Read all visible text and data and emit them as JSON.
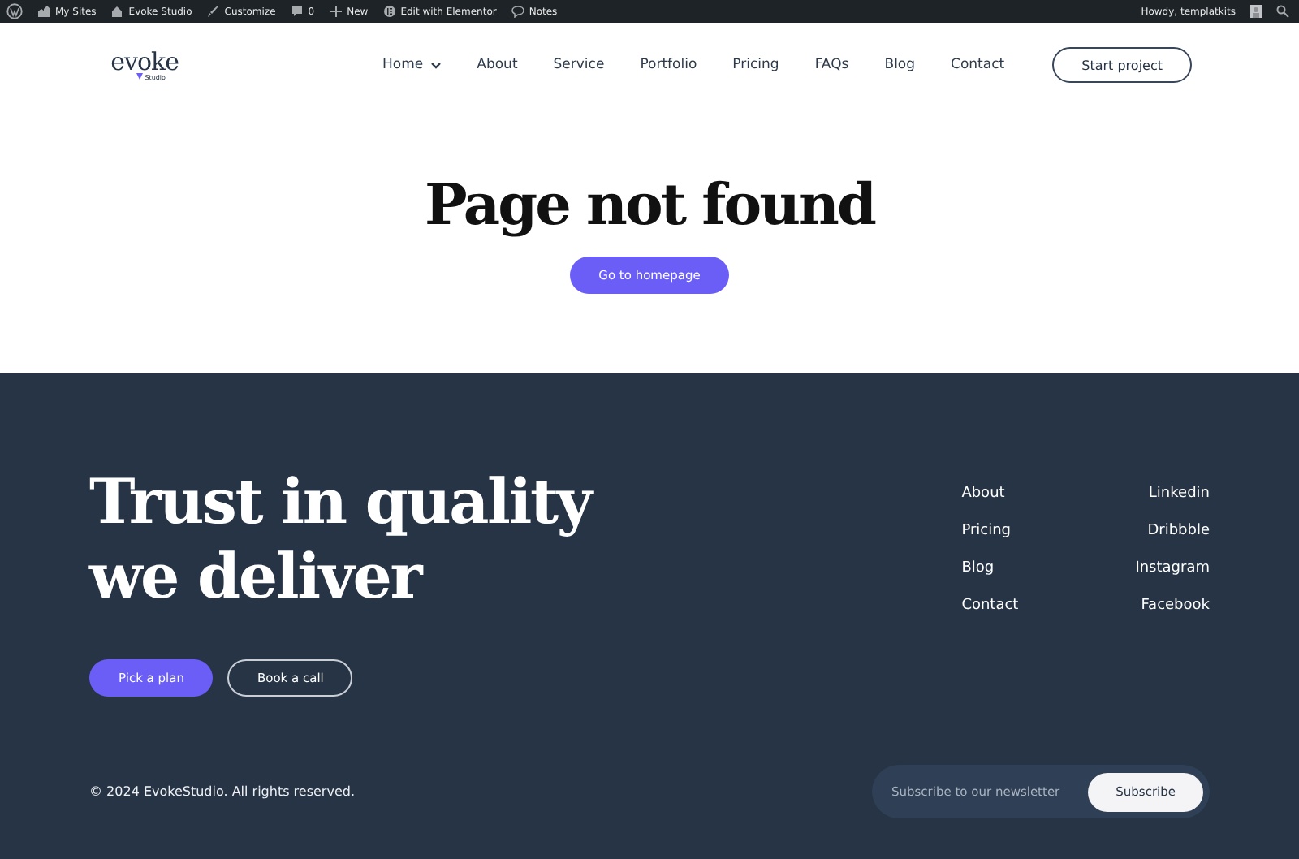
{
  "admin_bar": {
    "items": [
      {
        "kind": "logo"
      },
      {
        "kind": "sites",
        "label": "My Sites"
      },
      {
        "kind": "home",
        "label": "Evoke Studio"
      },
      {
        "kind": "brush",
        "label": "Customize"
      },
      {
        "kind": "comments",
        "label": "0"
      },
      {
        "kind": "plus",
        "label": "New"
      },
      {
        "kind": "elementor",
        "label": "Edit with Elementor"
      },
      {
        "kind": "notes",
        "label": "Notes"
      }
    ],
    "greeting": "Howdy, templatkits"
  },
  "header": {
    "logo": {
      "word": "evoke",
      "sub": "Studio"
    },
    "nav": [
      {
        "label": "Home",
        "dropdown": true
      },
      {
        "label": "About",
        "dropdown": false
      },
      {
        "label": "Service",
        "dropdown": false
      },
      {
        "label": "Portfolio",
        "dropdown": false
      },
      {
        "label": "Pricing",
        "dropdown": false
      },
      {
        "label": "FAQs",
        "dropdown": false
      },
      {
        "label": "Blog",
        "dropdown": false
      },
      {
        "label": "Contact",
        "dropdown": false
      }
    ],
    "cta": "Start project"
  },
  "hero": {
    "title": "Page not found",
    "button": "Go to homepage"
  },
  "footer": {
    "heading": [
      "Trust in quality",
      "we deliver"
    ],
    "primary_button": "Pick a plan",
    "secondary_button": "Book a call",
    "links_left": [
      "About",
      "Pricing",
      "Blog",
      "Contact"
    ],
    "links_right": [
      "Linkedin",
      "Dribbble",
      "Instagram",
      "Facebook"
    ],
    "copyright": "© 2024 EvokeStudio. All rights reserved.",
    "newsletter": {
      "placeholder": "Subscribe to our newsletter",
      "button": "Subscribe"
    }
  }
}
